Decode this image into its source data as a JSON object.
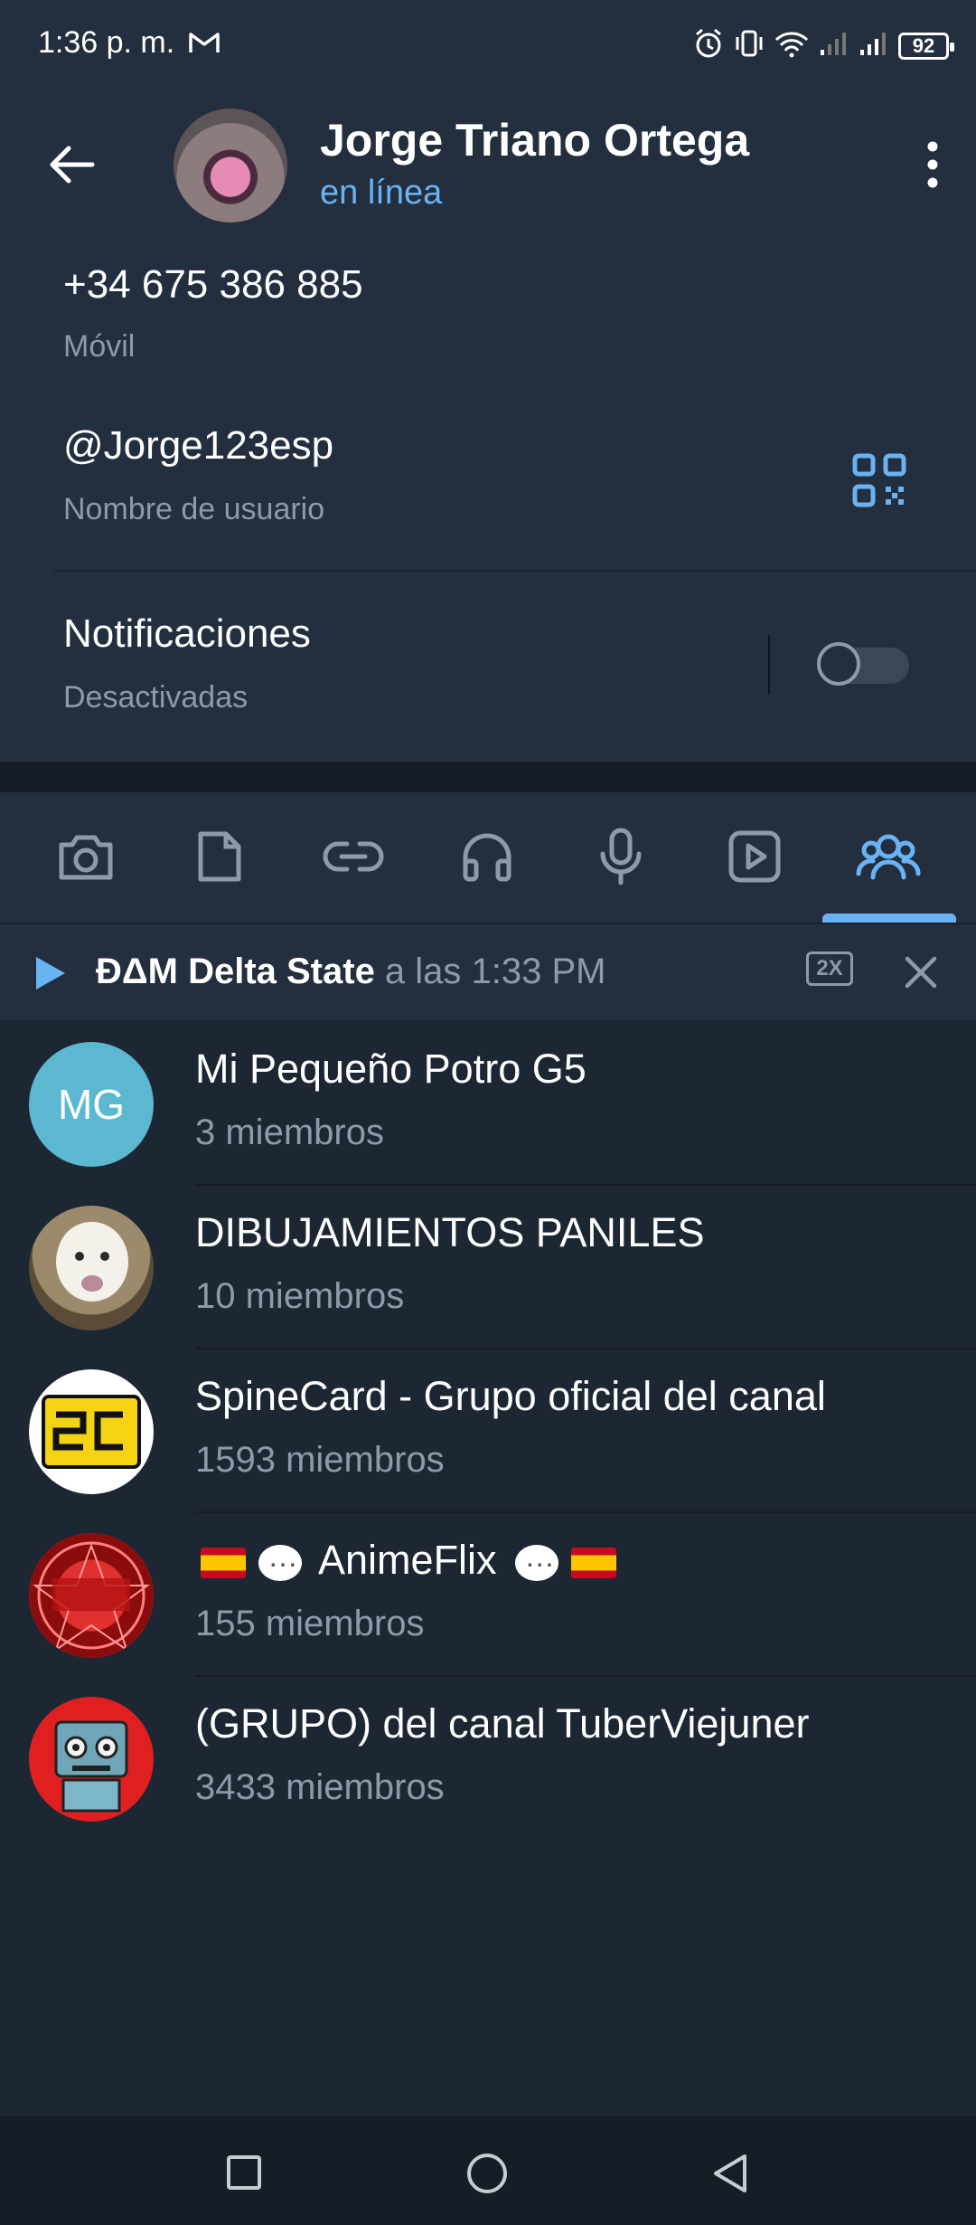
{
  "status_bar": {
    "time": "1:36 p. m.",
    "battery": "92"
  },
  "header": {
    "name": "Jorge Triano Ortega",
    "status": "en línea"
  },
  "info": {
    "phone": "+34 675 386 885",
    "phone_label": "Móvil",
    "username": "@Jorge123esp",
    "username_label": "Nombre de usuario",
    "notifications": "Notificaciones",
    "notifications_state": "Desactivadas"
  },
  "tabs": [
    "camera-icon",
    "file-icon",
    "link-icon",
    "headphones-icon",
    "mic-icon",
    "video-icon",
    "groups-icon"
  ],
  "player": {
    "title": "ĐΔM Delta State",
    "time": " a las 1:33 PM",
    "speed": "2X"
  },
  "groups": [
    {
      "name": "Mi Pequeño Potro G5",
      "members": "3 miembros",
      "initials": "MG",
      "color": "#5bb8d0"
    },
    {
      "name": "DIBUJAMIENTOS PANILES",
      "members": "10 miembros"
    },
    {
      "name": "SpineCard - Grupo oficial del canal",
      "members": "1593 miembros"
    },
    {
      "name": " AnimeFlix ",
      "members": "155 miembros"
    },
    {
      "name": "(GRUPO) del canal TuberViejuner",
      "members": "3433 miembros"
    }
  ],
  "colors": {
    "accent": "#6ab3f3",
    "background": "#1d2733",
    "surface": "#232f3e",
    "muted_text": "#8d9ba8"
  }
}
